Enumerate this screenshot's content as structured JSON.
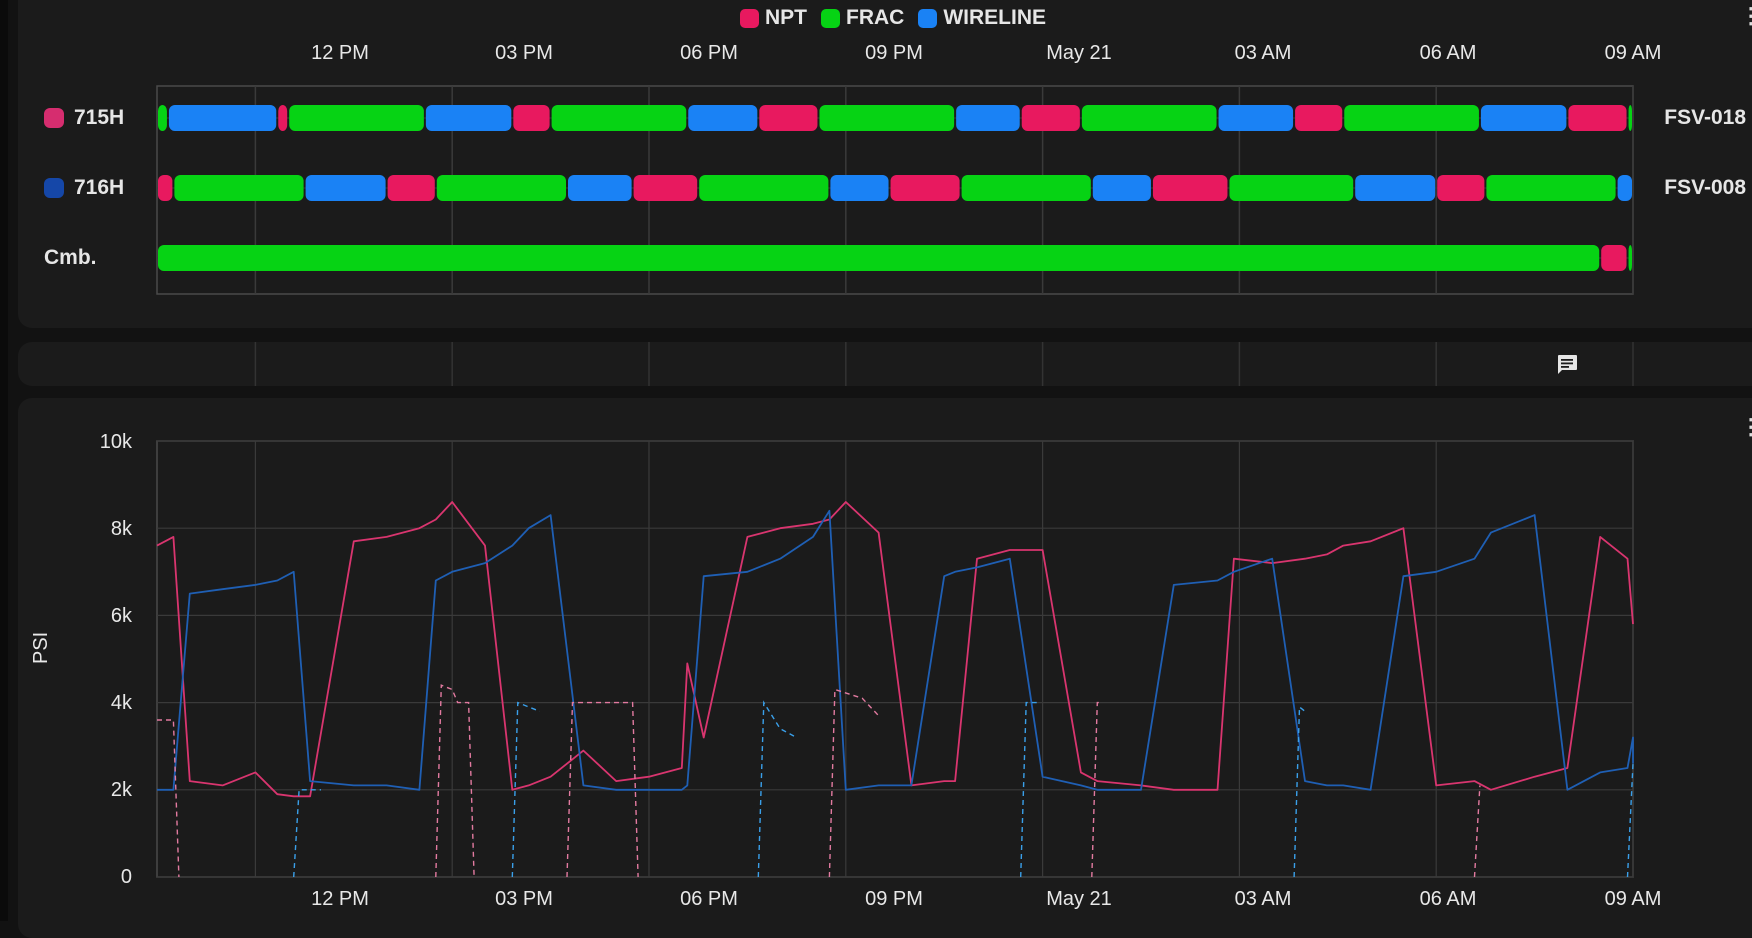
{
  "legend": [
    {
      "label": "NPT",
      "color": "#e8195f"
    },
    {
      "label": "FRAC",
      "color": "#06d314"
    },
    {
      "label": "WIRELINE",
      "color": "#1a82f5"
    }
  ],
  "time_axis_labels": [
    "12 PM",
    "03 PM",
    "06 PM",
    "09 PM",
    "May 21",
    "03 AM",
    "06 AM",
    "09 AM"
  ],
  "rows": [
    {
      "name": "715H",
      "swatch_color": "#d62d6f",
      "rig": "FSV-018"
    },
    {
      "name": "716H",
      "swatch_color": "#1547a8",
      "rig": "FSV-008"
    },
    {
      "name": "Cmb.",
      "swatch_color": "",
      "rig": ""
    }
  ],
  "timeline": {
    "start": "May 20 10:30",
    "end": "May 21 09:00",
    "segments_715H": [
      [
        "FRAC",
        "10:30",
        "10:40"
      ],
      [
        "WIRELINE",
        "10:40",
        "12:20"
      ],
      [
        "NPT",
        "12:20",
        "12:30"
      ],
      [
        "FRAC",
        "12:30",
        "14:35"
      ],
      [
        "WIRELINE",
        "14:35",
        "15:55"
      ],
      [
        "NPT",
        "15:55",
        "16:30"
      ],
      [
        "FRAC",
        "16:30",
        "18:35"
      ],
      [
        "WIRELINE",
        "18:35",
        "19:40"
      ],
      [
        "NPT",
        "19:40",
        "20:35"
      ],
      [
        "FRAC",
        "20:35",
        "22:40"
      ],
      [
        "WIRELINE",
        "22:40",
        "23:40"
      ],
      [
        "NPT",
        "23:40",
        "00:35"
      ],
      [
        "FRAC",
        "00:35",
        "02:40"
      ],
      [
        "WIRELINE",
        "02:40",
        "03:50"
      ],
      [
        "NPT",
        "03:50",
        "04:35"
      ],
      [
        "FRAC",
        "04:35",
        "06:40"
      ],
      [
        "WIRELINE",
        "06:40",
        "08:00"
      ],
      [
        "NPT",
        "08:00",
        "08:55"
      ],
      [
        "FRAC",
        "08:55",
        "09:40"
      ]
    ],
    "segments_716H": [
      [
        "NPT",
        "10:30",
        "10:45"
      ],
      [
        "FRAC",
        "10:45",
        "12:45"
      ],
      [
        "WIRELINE",
        "12:45",
        "14:00"
      ],
      [
        "NPT",
        "14:00",
        "14:45"
      ],
      [
        "FRAC",
        "14:45",
        "16:45"
      ],
      [
        "WIRELINE",
        "16:45",
        "17:45"
      ],
      [
        "NPT",
        "17:45",
        "18:45"
      ],
      [
        "FRAC",
        "18:45",
        "20:45"
      ],
      [
        "WIRELINE",
        "20:45",
        "21:40"
      ],
      [
        "NPT",
        "21:40",
        "22:45"
      ],
      [
        "FRAC",
        "22:45",
        "00:45"
      ],
      [
        "WIRELINE",
        "00:45",
        "01:40"
      ],
      [
        "NPT",
        "01:40",
        "02:50"
      ],
      [
        "FRAC",
        "02:50",
        "04:45"
      ],
      [
        "WIRELINE",
        "04:45",
        "06:00"
      ],
      [
        "NPT",
        "06:00",
        "06:45"
      ],
      [
        "FRAC",
        "06:45",
        "08:45"
      ],
      [
        "WIRELINE",
        "08:45",
        "09:40"
      ]
    ],
    "segments_Cmb": [
      [
        "FRAC",
        "10:30",
        "08:30"
      ],
      [
        "NPT",
        "08:30",
        "08:55"
      ],
      [
        "FRAC",
        "08:55",
        "09:40"
      ]
    ]
  },
  "pressure_chart": {
    "ylabel": "PSI",
    "y_ticks": [
      "10k",
      "8k",
      "6k",
      "4k",
      "2k",
      "0"
    ]
  },
  "chart_data": {
    "type": "line",
    "x_axis": "time (May 20 10:30 – May 21 09:00)",
    "ylabel": "PSI",
    "ylim": [
      0,
      10000
    ],
    "y_ticks": [
      0,
      2000,
      4000,
      6000,
      8000,
      10000
    ],
    "x_tick_labels": [
      "12 PM",
      "03 PM",
      "06 PM",
      "09 PM",
      "May 21",
      "03 AM",
      "06 AM",
      "09 AM"
    ],
    "grid": true,
    "series": [
      {
        "color": "#d9356f",
        "style": "solid",
        "x": [
          "10:30",
          "10:45",
          "11:00",
          "11:30",
          "12:00",
          "12:20",
          "12:35",
          "12:50",
          "13:30",
          "14:00",
          "14:30",
          "14:45",
          "15:00",
          "15:30",
          "15:55",
          "16:10",
          "16:30",
          "17:00",
          "17:30",
          "18:00",
          "18:30",
          "18:35",
          "18:50",
          "19:30",
          "20:00",
          "20:30",
          "20:45",
          "21:00",
          "21:30",
          "22:00",
          "22:30",
          "22:40",
          "23:00",
          "23:30",
          "00:00",
          "00:35",
          "00:50",
          "01:30",
          "02:00",
          "02:40",
          "02:55",
          "03:30",
          "04:00",
          "04:20",
          "04:35",
          "05:00",
          "05:30",
          "06:00",
          "06:35",
          "06:50",
          "07:30",
          "08:00",
          "08:30",
          "08:55",
          "09:10",
          "09:30",
          "09:40"
        ],
        "y": [
          7600,
          7800,
          2200,
          2100,
          2400,
          1900,
          1850,
          1850,
          7700,
          7800,
          8000,
          8200,
          8600,
          7600,
          2000,
          2100,
          2300,
          2900,
          2200,
          2300,
          2500,
          4900,
          3200,
          7800,
          8000,
          8100,
          8200,
          8600,
          7900,
          2100,
          2200,
          2200,
          7300,
          7500,
          7500,
          2400,
          2200,
          2100,
          2000,
          2000,
          7300,
          7200,
          7300,
          7400,
          7600,
          7700,
          8000,
          2100,
          2200,
          2000,
          2300,
          2500,
          7800,
          7300,
          5800,
          5800,
          5800
        ]
      },
      {
        "color": "#1f5fb4",
        "style": "solid",
        "x": [
          "10:30",
          "10:45",
          "11:00",
          "11:30",
          "12:00",
          "12:20",
          "12:35",
          "12:50",
          "13:30",
          "14:00",
          "14:30",
          "14:45",
          "15:00",
          "15:30",
          "15:55",
          "16:10",
          "16:30",
          "17:00",
          "17:30",
          "18:00",
          "18:30",
          "18:35",
          "18:50",
          "19:30",
          "20:00",
          "20:30",
          "20:45",
          "21:00",
          "21:30",
          "22:00",
          "22:30",
          "22:40",
          "23:00",
          "23:30",
          "00:00",
          "00:35",
          "00:50",
          "01:30",
          "02:00",
          "02:40",
          "02:55",
          "03:30",
          "04:00",
          "04:20",
          "04:35",
          "05:00",
          "05:30",
          "06:00",
          "06:35",
          "06:50",
          "07:30",
          "08:00",
          "08:30",
          "08:55",
          "09:10",
          "09:30",
          "09:40"
        ],
        "y": [
          2000,
          2000,
          6500,
          6600,
          6700,
          6800,
          7000,
          2200,
          2100,
          2100,
          2000,
          6800,
          7000,
          7200,
          7600,
          8000,
          8300,
          2100,
          2000,
          2000,
          2000,
          2100,
          6900,
          7000,
          7300,
          7800,
          8400,
          2000,
          2100,
          2100,
          6900,
          7000,
          7100,
          7300,
          2300,
          2100,
          2000,
          2000,
          6700,
          6800,
          7000,
          7300,
          2200,
          2100,
          2100,
          2000,
          6900,
          7000,
          7300,
          7900,
          8300,
          2000,
          2400,
          2500,
          3200,
          2800,
          2600
        ]
      }
    ]
  }
}
